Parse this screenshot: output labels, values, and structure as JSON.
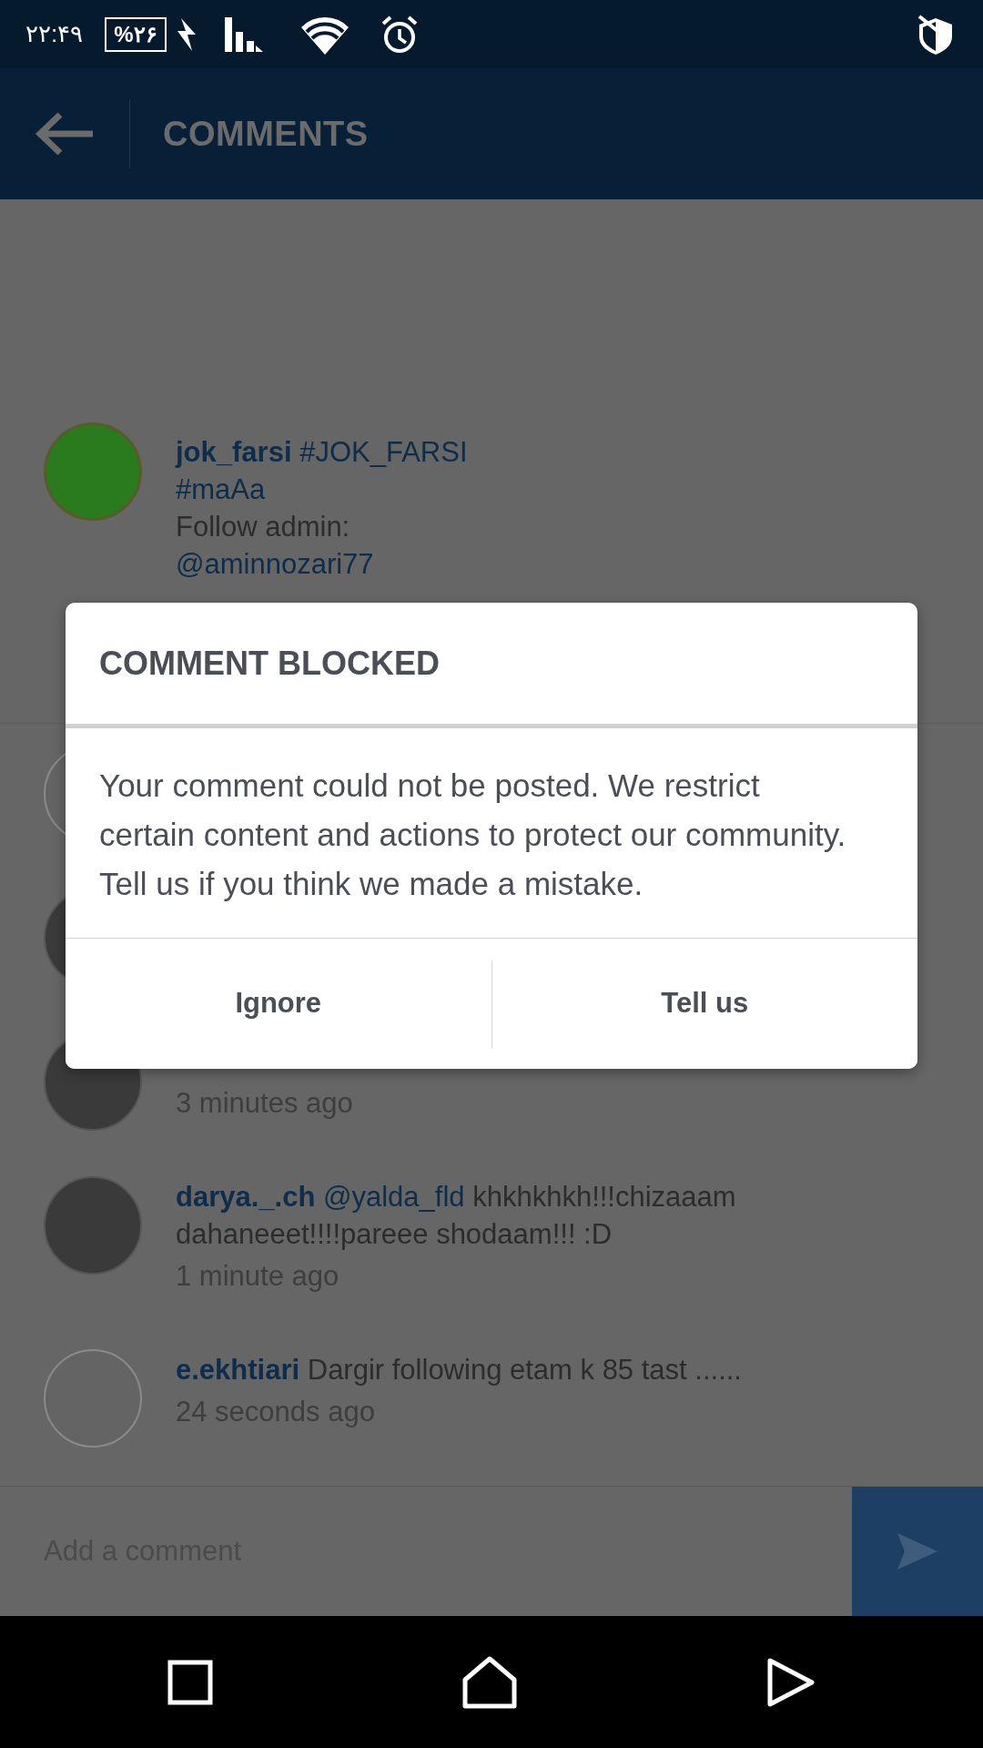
{
  "status_bar": {
    "time": "۲۲:۴۹",
    "battery": "%۲۶"
  },
  "app_bar": {
    "title": "COMMENTS"
  },
  "caption": {
    "kind": "logo",
    "segments": [
      {
        "kind": "user",
        "text": "jok_farsi"
      },
      {
        "kind": "tag",
        "text": "#JOK_FARSI"
      },
      {
        "kind": "break"
      },
      {
        "kind": "tag",
        "text": "#maAa"
      },
      {
        "kind": "break"
      },
      {
        "kind": "plain",
        "text": "Follow admin:"
      },
      {
        "kind": "break"
      },
      {
        "kind": "tag",
        "text": "@aminnozari77"
      }
    ]
  },
  "comments": [
    {
      "kind": "outline"
    },
    {
      "kind": "photo"
    },
    {
      "kind": "photo",
      "time": "3 minutes ago"
    },
    {
      "kind": "photo",
      "username": "darya._.ch",
      "mention": "@yalda_fld",
      "text": "khkhkhkh!!!chizaaam dahaneeet!!!!pareee shodaam!!! :D",
      "time": "1 minute ago"
    },
    {
      "kind": "outline",
      "username": "e.ekhtiari",
      "text": "Dargir following etam k 85 tast ......",
      "time": "24 seconds ago"
    }
  ],
  "comment_input": {
    "placeholder": "Add a comment"
  },
  "dialog": {
    "title": "COMMENT BLOCKED",
    "message": "Your comment could not be posted. We restrict certain content and actions to protect our community. Tell us if you think we made a mistake.",
    "buttons": [
      "Ignore",
      "Tell us"
    ]
  }
}
